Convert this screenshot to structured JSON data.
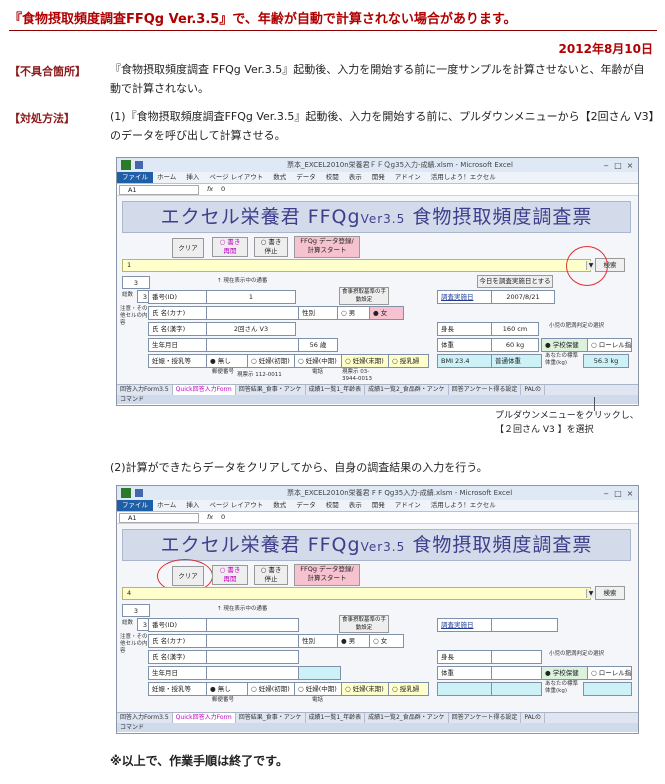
{
  "header": {
    "title": "『食物摂取頻度調査FFQg Ver.3.5』で、年齢が自動で計算されない場合があります。",
    "date": "2012年8月10日"
  },
  "sections": {
    "defect_label": "【不具合箇所】",
    "defect_text_1": "『食物摂取頻度調査 FFQg Ver.3.5』起動後、入力を開始する前に一度サンプルを計算させないと、年齢が自",
    "defect_text_2": "動で計算されない。",
    "method_label": "【対処方法】",
    "step1_text_1": "(1)『食物摂取頻度調査FFQg Ver.3.5』起動後、入力を開始する前に、プルダウンメニューから【2回さん V3】",
    "step1_text_2": "のデータを呼び出して計算させる。",
    "step2_text": "(2)計算ができたらデータをクリアしてから、自身の調査結果の入力を行う。",
    "closing_note": "※以上で、作業手順は終了です。"
  },
  "callout": {
    "line1": "プルダウンメニューをクリックし、",
    "line2": "【２回さん V3 】を選択"
  },
  "excel": {
    "window_title_1": "票本_EXCEL2010n栄養君ＦＦＱg35入力-成績.xlsm - Microsoft Excel",
    "window_title_2": "票本_EXCEL2010n栄養君 F F Qg35入力-成績.xlsm - Microsoft Excel",
    "win_buttons": [
      "‒",
      "□",
      "×"
    ],
    "ribbon_file": "ファイル",
    "ribbon_tabs": [
      "ホーム",
      "挿入",
      "ページ レイアウト",
      "数式",
      "データ",
      "校閲",
      "表示",
      "開発",
      "アドイン",
      "活用しよう！エクセル"
    ],
    "name_box": "A1",
    "fx": "fx",
    "formula_value": "0",
    "banner_main": "エクセル栄養君 FFQg",
    "banner_ver": "Ver3.5",
    "banner_tail": "食物摂取頻度調査票",
    "btn_clear": "クリア",
    "btn_write_open_1": "○ 書き",
    "btn_write_open_2": "再開",
    "btn_write_stop_1": "○ 書き",
    "btn_write_stop_2": "停止",
    "btn_calc_1": "FFQg データ登録/",
    "btn_calc_2": "計算スタート",
    "search_btn": "検索",
    "cur_label": "↑ 現在表示中の通番",
    "today_btn": "今日を調査実施日とする",
    "cnt_label": "総数",
    "note_left": "注意・その他セルの内容",
    "fields": {
      "number": "番号(ID)",
      "name_kana": "氏 名(カナ)",
      "name_kanji": "氏 名(漢字)",
      "birthday": "生年月日",
      "pregnancy": "妊娠・授乳等",
      "sex": "性別",
      "male": "○ 男",
      "female": "● 女",
      "female_empty": "○ 女",
      "male_checked": "● 男",
      "survey_date": "調査実施日",
      "height": "身長",
      "weight": "体重",
      "meal_std": "食事摂取基準の手動設定",
      "child_obesity": "小児の肥満判定の選択",
      "school": "● 学校保健",
      "rohrer": "○ ローレル指数",
      "preg_none": "● 無し",
      "preg_early": "○ 妊婦(初期)",
      "preg_mid": "○ 妊婦(中期)",
      "preg_late": "○ 妊婦(末期)",
      "lactating": "○ 授乳婦",
      "std_weight": "あなたの標準体重(kg)",
      "address_label": "郵便番号",
      "phone_label": "電話"
    },
    "values1": {
      "dropdown": "1",
      "total": "3",
      "seq": "3",
      "id": "1",
      "name_kanji": "2回さん V3",
      "survey_date": "2007/8/21",
      "height": "160 cm",
      "weight": "60 kg",
      "age": "56 歳",
      "bmi": "BMI 23.4",
      "bmi_class": "普通体重",
      "std_weight": "56.3 kg",
      "postal": "現票示 112-0011",
      "phone": "現票示 03-3944-0013"
    },
    "values2": {
      "dropdown": "4",
      "total": "3",
      "seq": "3"
    },
    "sheet_tabs": [
      "回答入力Form3.5",
      "Quick回答入力Form",
      "回答結果_食事・アンケ",
      "成績1一覧1_年齢表",
      "成績1一覧2_食品群・アンケ",
      "回答アンケート得る設定",
      "PALの"
    ],
    "status": "コマンド"
  }
}
